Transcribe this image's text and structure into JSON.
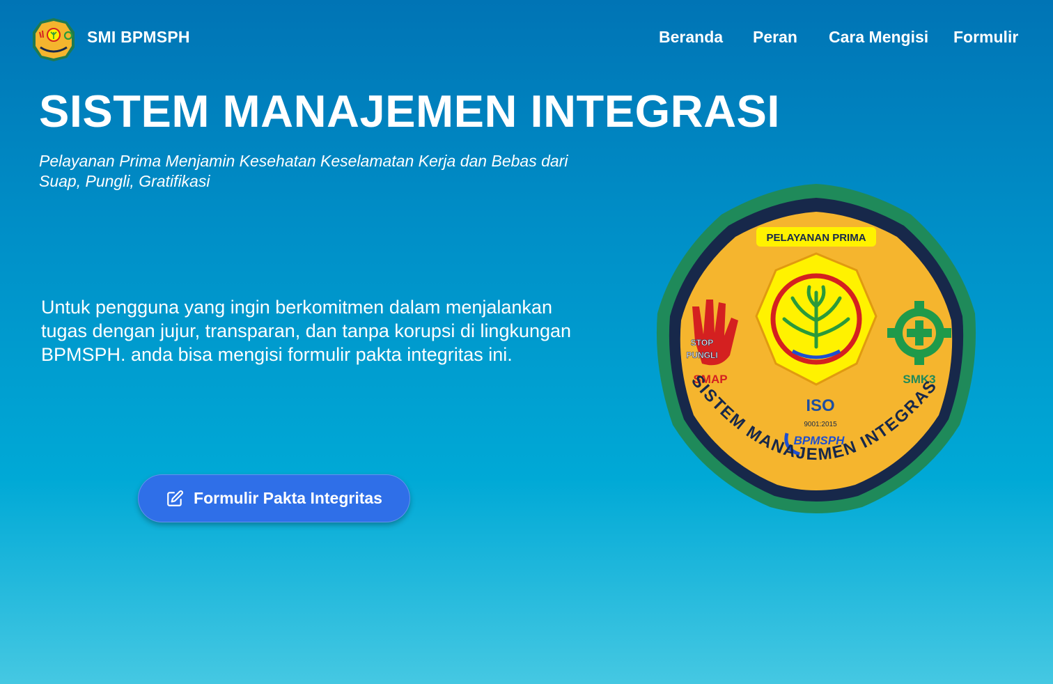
{
  "header": {
    "brand_name": "SMI BPMSPH",
    "nav": {
      "beranda": "Beranda",
      "peran": "Peran",
      "cara_mengisi": "Cara Mengisi",
      "formulir": "Formulir"
    }
  },
  "hero": {
    "title": "SISTEM MANAJEMEN INTEGRASI",
    "subtitle_line1": "Pelayanan Prima Menjamin Kesehatan Keselamatan Kerja dan Bebas dari",
    "subtitle_line2": "Suap, Pungli, Gratifikasi",
    "description": "Untuk pengguna yang ingin berkomitmen dalam menjalankan tugas dengan jujur, transparan, dan tanpa korupsi di lingkungan BPMSPH. anda bisa mengisi formulir pakta integritas ini.",
    "cta_label": "Formulir Pakta Integritas",
    "cta_icon": "edit-icon"
  },
  "emblem": {
    "top_label": "PELAYANAN PRIMA",
    "stop_line1": "STOP",
    "stop_line2": "PUNGLI",
    "smap": "SMAP",
    "smk3": "SMK3",
    "iso": "ISO",
    "iso_number": "9001:2015",
    "bpmsph": "BPMSPH",
    "arc_text": "SISTEM MANAJEMEN INTEGRASI"
  },
  "colors": {
    "cta_blue": "#2f6fe8",
    "emblem_yellow": "#f5b52e",
    "emblem_green": "#1f8a5a",
    "emblem_navy": "#17284a"
  }
}
